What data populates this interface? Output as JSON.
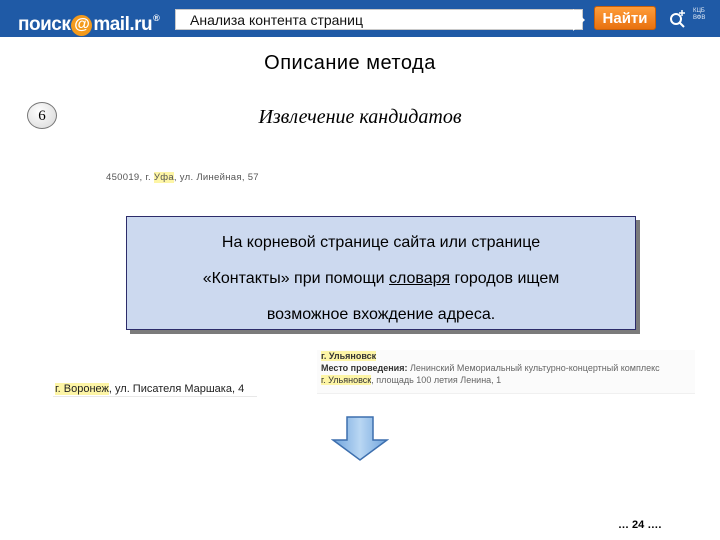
{
  "header": {
    "logo": {
      "pre": "поиск",
      "at": "@",
      "post": "mail.ru",
      "reg": "®"
    },
    "search_value": "Анализа контента страниц",
    "find_label": "Найти",
    "caption_top": "КЦБ",
    "caption_bottom": "ВФВ"
  },
  "slide": {
    "title": "Описание метода",
    "step_number": "6",
    "subtitle": "Извлечение кандидатов",
    "callout": {
      "line1": "На корневой странице сайта или странице",
      "line2_before": "«Контакты»  при помощи ",
      "line2_link": "словаря",
      "line2_after": " городов ищем",
      "line3": "возможное вхождение адреса."
    },
    "page_number": "… 24 …."
  },
  "snippets": {
    "address1": {
      "before": "450019, г. ",
      "highlight": "Уфа",
      "after": ", ул. Линейная, 57"
    },
    "address2": {
      "row1_highlight": "г. Ульяновск",
      "row2_label": "Место проведения:",
      "row2_text": " Ленинский Мемориальный культурно-концертный комплекс",
      "row3_highlight": "г. Ульяновск",
      "row3_text": ", площадь 100 летия Ленина, 1"
    },
    "address3": {
      "highlight": "г. Воронеж",
      "after": ", ул. Писателя Маршака, 4"
    }
  },
  "colors": {
    "header_bg": "#1f5aa6",
    "find_button": "#f08a25",
    "callout_bg": "#ccd9ef",
    "highlight": "#fdf5a6",
    "arrow_fill": "#9cc3ea"
  },
  "icons": {
    "logo_at": "at-sign-icon",
    "header_tool": "magnifier-plus-icon",
    "arrow": "arrow-down-icon"
  }
}
